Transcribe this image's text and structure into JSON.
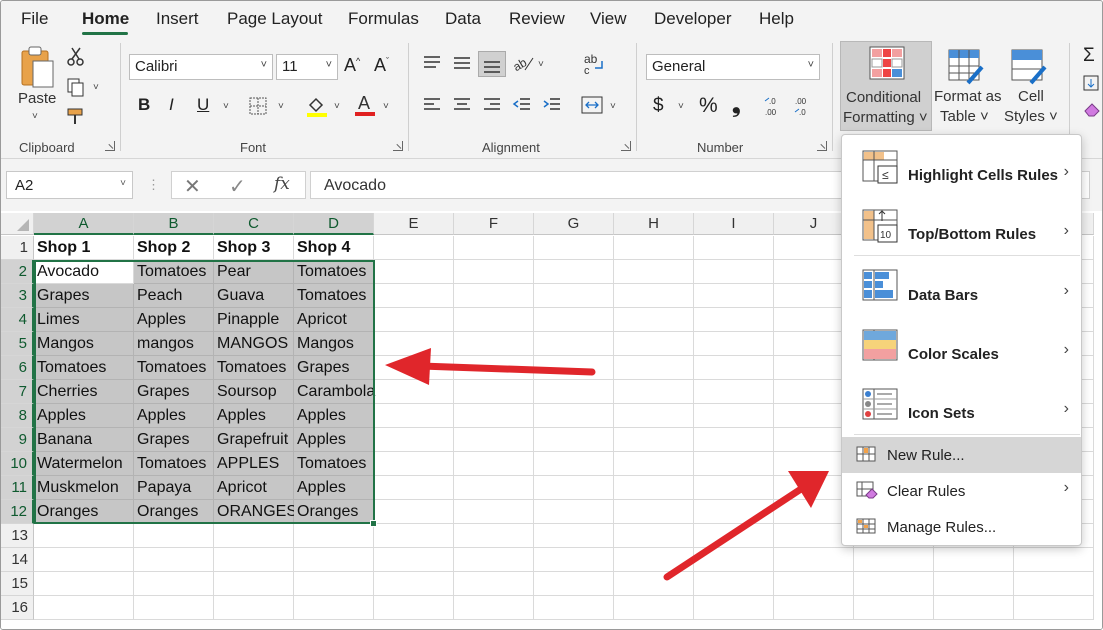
{
  "menu": {
    "tabs": [
      "File",
      "Home",
      "Insert",
      "Page Layout",
      "Formulas",
      "Data",
      "Review",
      "View",
      "Developer",
      "Help"
    ],
    "active": "Home"
  },
  "ribbon": {
    "clipboard": {
      "paste_label": "Paste",
      "group_label": "Clipboard"
    },
    "font": {
      "family": "Calibri",
      "size": "11",
      "group_label": "Font",
      "bold": "B",
      "italic": "I",
      "underline": "U"
    },
    "alignment": {
      "group_label": "Alignment"
    },
    "number": {
      "format": "General",
      "group_label": "Number",
      "currency": "$",
      "percent": "%",
      "comma": "❟"
    },
    "styles": {
      "conditional_formatting": [
        "Conditional",
        "Formatting ˅"
      ],
      "format_as_table": [
        "Format as",
        "Table ˅"
      ],
      "cell_styles": [
        "Cell",
        "Styles ˅"
      ]
    }
  },
  "formula_bar": {
    "name_box": "A2",
    "fx": "fx",
    "value": "Avocado"
  },
  "sheet": {
    "columns": [
      "A",
      "B",
      "C",
      "D",
      "E",
      "F",
      "G",
      "H",
      "I",
      "J"
    ],
    "rows": [
      "1",
      "2",
      "3",
      "4",
      "5",
      "6",
      "7",
      "8",
      "9",
      "10",
      "11",
      "12",
      "13",
      "14",
      "15",
      "16"
    ],
    "data": [
      [
        "Shop 1",
        "Shop 2",
        "Shop 3",
        "Shop 4"
      ],
      [
        "Avocado",
        "Tomatoes",
        "Pear",
        "Tomatoes"
      ],
      [
        "Grapes",
        "Peach",
        "Guava",
        "Tomatoes"
      ],
      [
        "Limes",
        "Apples",
        "Pinapple",
        "Apricot"
      ],
      [
        "Mangos",
        "mangos",
        "MANGOS",
        "Mangos"
      ],
      [
        "Tomatoes",
        "Tomatoes",
        "Tomatoes",
        "Grapes"
      ],
      [
        "Cherries",
        "Grapes",
        "Soursop",
        "Carambola"
      ],
      [
        "Apples",
        "Apples",
        "Apples",
        "Apples"
      ],
      [
        "Banana",
        "Grapes",
        "Grapefruit",
        "Apples"
      ],
      [
        "Watermelon",
        "Tomatoes",
        "APPLES",
        "Tomatoes"
      ],
      [
        "Muskmelon",
        "Papaya",
        "Apricot",
        "Apples"
      ],
      [
        "Oranges",
        "Oranges",
        "ORANGES",
        "Oranges"
      ]
    ]
  },
  "dropdown": {
    "items": [
      {
        "label": "Highlight Cells Rules",
        "bold": true,
        "submenu": true
      },
      {
        "label": "Top/Bottom Rules",
        "bold": true,
        "submenu": true
      },
      {
        "label": "Data Bars",
        "bold": true,
        "submenu": true
      },
      {
        "label": "Color Scales",
        "bold": true,
        "submenu": true
      },
      {
        "label": "Icon Sets",
        "bold": true,
        "submenu": true
      },
      {
        "label": "New Rule...",
        "bold": false,
        "submenu": false,
        "highlighted": true
      },
      {
        "label": "Clear Rules",
        "bold": false,
        "submenu": true
      },
      {
        "label": "Manage Rules...",
        "bold": false,
        "submenu": false
      }
    ]
  },
  "colors": {
    "excel_green": "#217346",
    "arrow_red": "#e0262b",
    "selection_gray": "#c6c6c6"
  }
}
